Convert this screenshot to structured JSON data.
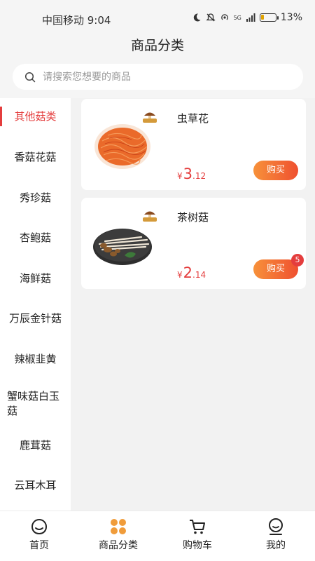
{
  "status_bar": {
    "carrier_time": "中国移动 9:04",
    "network": "5G",
    "battery": "13%"
  },
  "header": {
    "title": "商品分类"
  },
  "search": {
    "placeholder": "请搜索您想要的商品"
  },
  "categories": [
    {
      "label": "其他菇类",
      "active": true
    },
    {
      "label": "香菇花菇",
      "active": false
    },
    {
      "label": "秀珍菇",
      "active": false
    },
    {
      "label": "杏鲍菇",
      "active": false
    },
    {
      "label": "海鲜菇",
      "active": false
    },
    {
      "label": "万辰金针菇",
      "active": false
    },
    {
      "label": "辣椒韭黄",
      "active": false
    },
    {
      "label": "蟹味菇白玉菇",
      "active": false
    },
    {
      "label": "鹿茸菇",
      "active": false
    },
    {
      "label": "云耳木耳",
      "active": false
    }
  ],
  "products": [
    {
      "name": "虫草花",
      "price_symbol": "¥",
      "price_int": "3",
      "price_dec": ".12",
      "buy_label": "购买",
      "cart_count": ""
    },
    {
      "name": "茶树菇",
      "price_symbol": "¥",
      "price_int": "2",
      "price_dec": ".14",
      "buy_label": "购买",
      "cart_count": "5"
    }
  ],
  "tabbar": {
    "items": [
      {
        "label": "首页",
        "icon": "home-icon"
      },
      {
        "label": "商品分类",
        "icon": "category-icon"
      },
      {
        "label": "购物车",
        "icon": "cart-icon"
      },
      {
        "label": "我的",
        "icon": "profile-icon"
      }
    ],
    "active_color": "#f09c3a"
  },
  "colors": {
    "accent": "#e43d3d",
    "button_gradient_start": "#f7913a",
    "button_gradient_end": "#ef5030"
  }
}
